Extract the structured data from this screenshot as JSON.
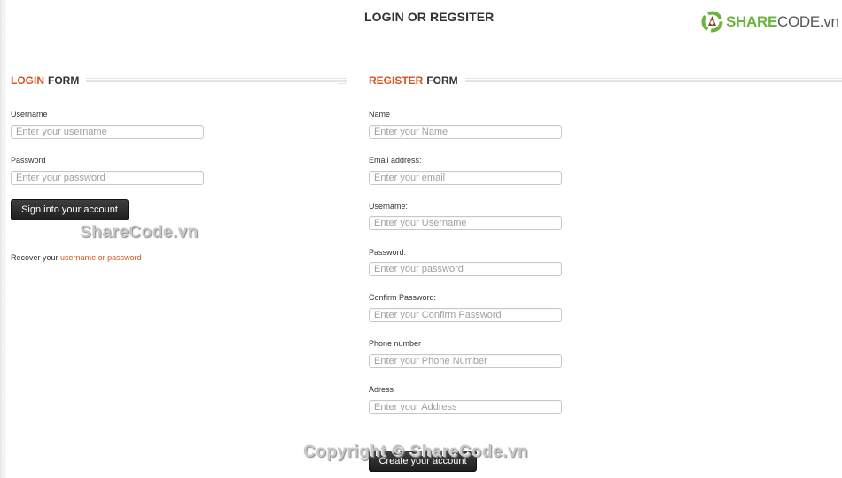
{
  "page": {
    "title": "LOGIN OR REGSITER"
  },
  "logo": {
    "brand_bold": "SHARE",
    "brand_rest": "CODE.vn",
    "icon": "sharecode-logo-icon",
    "colors": {
      "green": "#6cb33f",
      "brown": "#7a4a2a"
    }
  },
  "login": {
    "heading_accent": "LOGIN",
    "heading_rest": "FORM",
    "fields": [
      {
        "label": "Username",
        "placeholder": "Enter your username",
        "value": ""
      },
      {
        "label": "Password",
        "placeholder": "Enter your password",
        "value": ""
      }
    ],
    "submit_label": "Sign into your account",
    "recover_prefix": "Recover your",
    "recover_link": "username or password"
  },
  "register": {
    "heading_accent": "REGISTER",
    "heading_rest": "FORM",
    "fields": [
      {
        "label": "Name",
        "placeholder": "Enter your Name",
        "value": ""
      },
      {
        "label": "Email address:",
        "placeholder": "Enter your email",
        "value": ""
      },
      {
        "label": "Username:",
        "placeholder": "Enter your Username",
        "value": ""
      },
      {
        "label": "Password:",
        "placeholder": "Enter your password",
        "value": ""
      },
      {
        "label": "Confirm Password:",
        "placeholder": "Enter your Confirm Password",
        "value": ""
      },
      {
        "label": "Phone number",
        "placeholder": "Enter your Phone Number",
        "value": ""
      },
      {
        "label": "Adress",
        "placeholder": "Enter your Address",
        "value": ""
      }
    ],
    "submit_label": "Create your account"
  },
  "watermarks": {
    "middle": "ShareCode.vn",
    "bottom": "Copyright © ShareCode.vn"
  },
  "colors": {
    "accent": "#d4561f",
    "button_bg": "#2a2a2a",
    "text": "#333333"
  }
}
